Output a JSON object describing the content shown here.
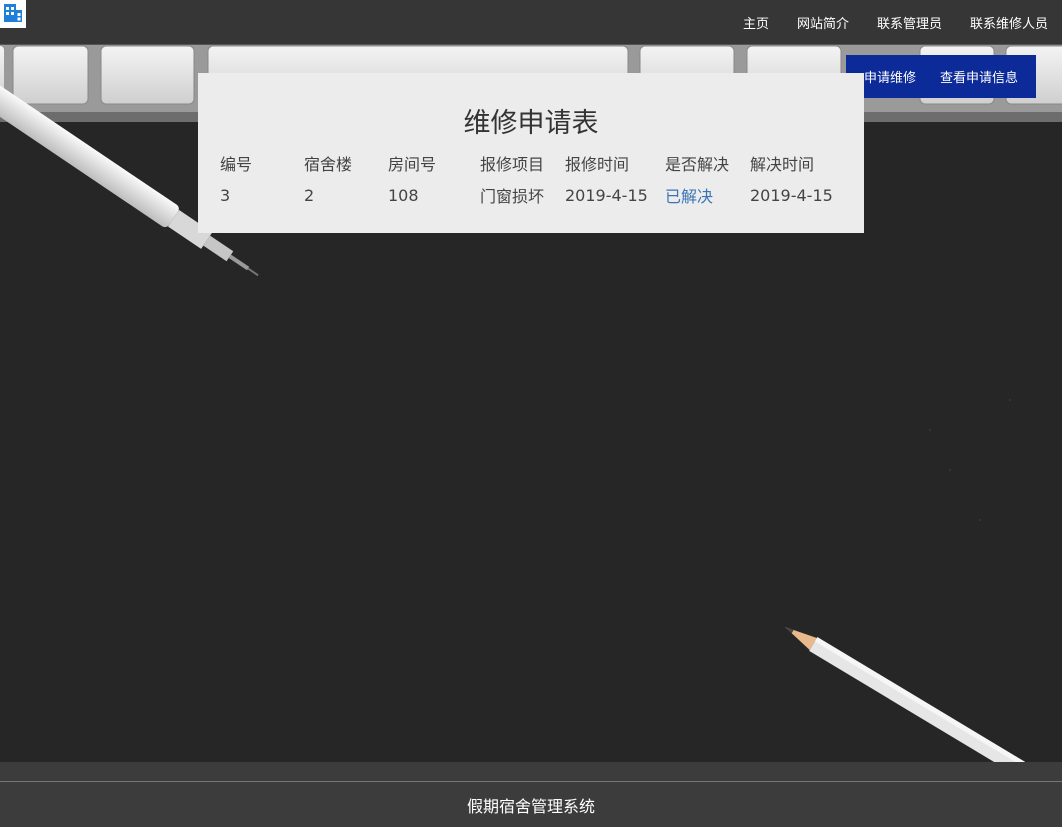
{
  "topbar": {
    "logo_icon": "building-icon",
    "nav_items": [
      {
        "label": "主页"
      },
      {
        "label": "网站简介"
      },
      {
        "label": "联系管理员"
      },
      {
        "label": "联系维修人员"
      }
    ]
  },
  "subnav": {
    "items": [
      {
        "label": "申请维修"
      },
      {
        "label": "查看申请信息"
      }
    ],
    "background": "#0d2a99"
  },
  "form": {
    "title": "维修申请表",
    "columns": [
      "编号",
      "宿舍楼",
      "房间号",
      "报修项目",
      "报修时间",
      "是否解决",
      "解决时间"
    ],
    "rows": [
      {
        "id": "3",
        "building": "2",
        "room": "108",
        "item": "门窗损坏",
        "report_time": "2019-4-15",
        "status": "已解决",
        "resolve_time": "2019-4-15"
      }
    ],
    "status_color": "#3a74b7"
  },
  "footer": {
    "text": "假期宿舍管理系统"
  }
}
